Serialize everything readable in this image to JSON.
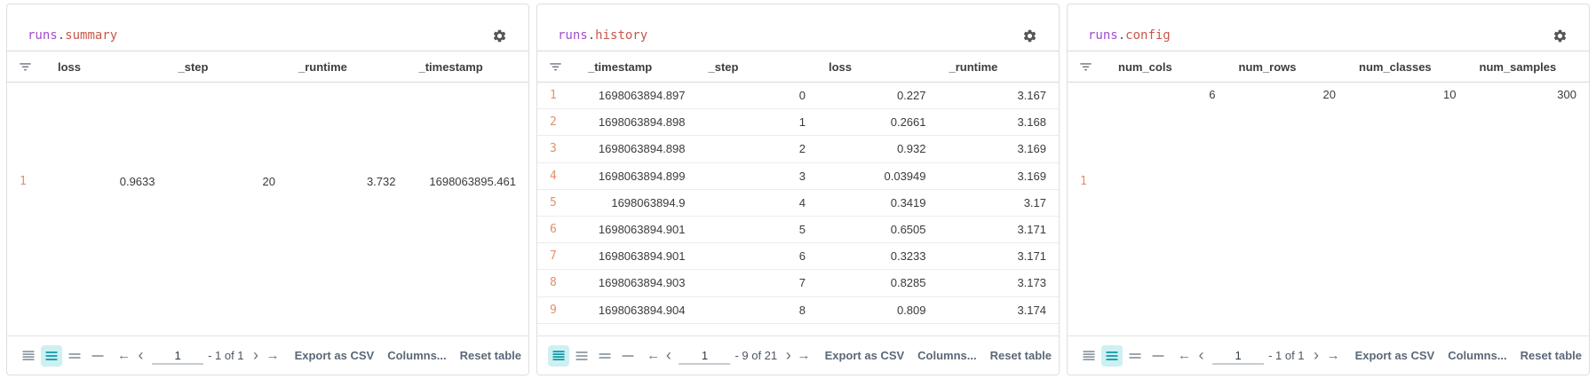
{
  "colors": {
    "title_prefix": "#a04fc9",
    "title_dot": "#52525b",
    "title_name": "#c9564a",
    "row_index": "#e2906c",
    "header_text": "#3d3d3d",
    "cell_text": "#3a3a3a",
    "accent_teal": "#0e97a7",
    "accent_teal_bg": "#cdf0f3",
    "icon_gray": "#8f99a3"
  },
  "toolbar": {
    "export_label": "Export as CSV",
    "columns_label": "Columns...",
    "reset_label": "Reset table",
    "nav": {
      "first": "←",
      "prev": "‹",
      "next": "›",
      "last": "→"
    }
  },
  "panels": [
    {
      "id": "summary",
      "title": {
        "prefix": "runs",
        "dot": ".",
        "name": "summary"
      },
      "columns": [
        "loss",
        "_step",
        "_runtime",
        "_timestamp"
      ],
      "rows": [
        {
          "index": "1",
          "values": [
            "0.9633",
            "20",
            "3.732",
            "1698063895.461"
          ]
        }
      ],
      "row_mode": "tall-centered",
      "density_selected": 1,
      "pagination": {
        "page": "1",
        "range_label": "- 1 of 1"
      }
    },
    {
      "id": "history",
      "title": {
        "prefix": "runs",
        "dot": ".",
        "name": "history"
      },
      "columns": [
        "_timestamp",
        "_step",
        "loss",
        "_runtime"
      ],
      "rows": [
        {
          "index": "1",
          "values": [
            "1698063894.897",
            "0",
            "0.227",
            "3.167"
          ]
        },
        {
          "index": "2",
          "values": [
            "1698063894.898",
            "1",
            "0.2661",
            "3.168"
          ]
        },
        {
          "index": "3",
          "values": [
            "1698063894.898",
            "2",
            "0.932",
            "3.169"
          ]
        },
        {
          "index": "4",
          "values": [
            "1698063894.899",
            "3",
            "0.03949",
            "3.169"
          ]
        },
        {
          "index": "5",
          "values": [
            "1698063894.9",
            "4",
            "0.3419",
            "3.17"
          ]
        },
        {
          "index": "6",
          "values": [
            "1698063894.901",
            "5",
            "0.6505",
            "3.171"
          ]
        },
        {
          "index": "7",
          "values": [
            "1698063894.901",
            "6",
            "0.3233",
            "3.171"
          ]
        },
        {
          "index": "8",
          "values": [
            "1698063894.903",
            "7",
            "0.8285",
            "3.173"
          ]
        },
        {
          "index": "9",
          "values": [
            "1698063894.904",
            "8",
            "0.809",
            "3.174"
          ]
        }
      ],
      "row_mode": "compact",
      "density_selected": 0,
      "pagination": {
        "page": "1",
        "range_label": "- 9 of 21"
      }
    },
    {
      "id": "config",
      "title": {
        "prefix": "runs",
        "dot": ".",
        "name": "config"
      },
      "columns": [
        "num_cols",
        "num_rows",
        "num_classes",
        "num_samples"
      ],
      "rows": [
        {
          "index": "1",
          "values": [
            "6",
            "20",
            "10",
            "300"
          ]
        }
      ],
      "row_mode": "tall-top",
      "density_selected": 1,
      "pagination": {
        "page": "1",
        "range_label": "- 1 of 1"
      }
    }
  ]
}
